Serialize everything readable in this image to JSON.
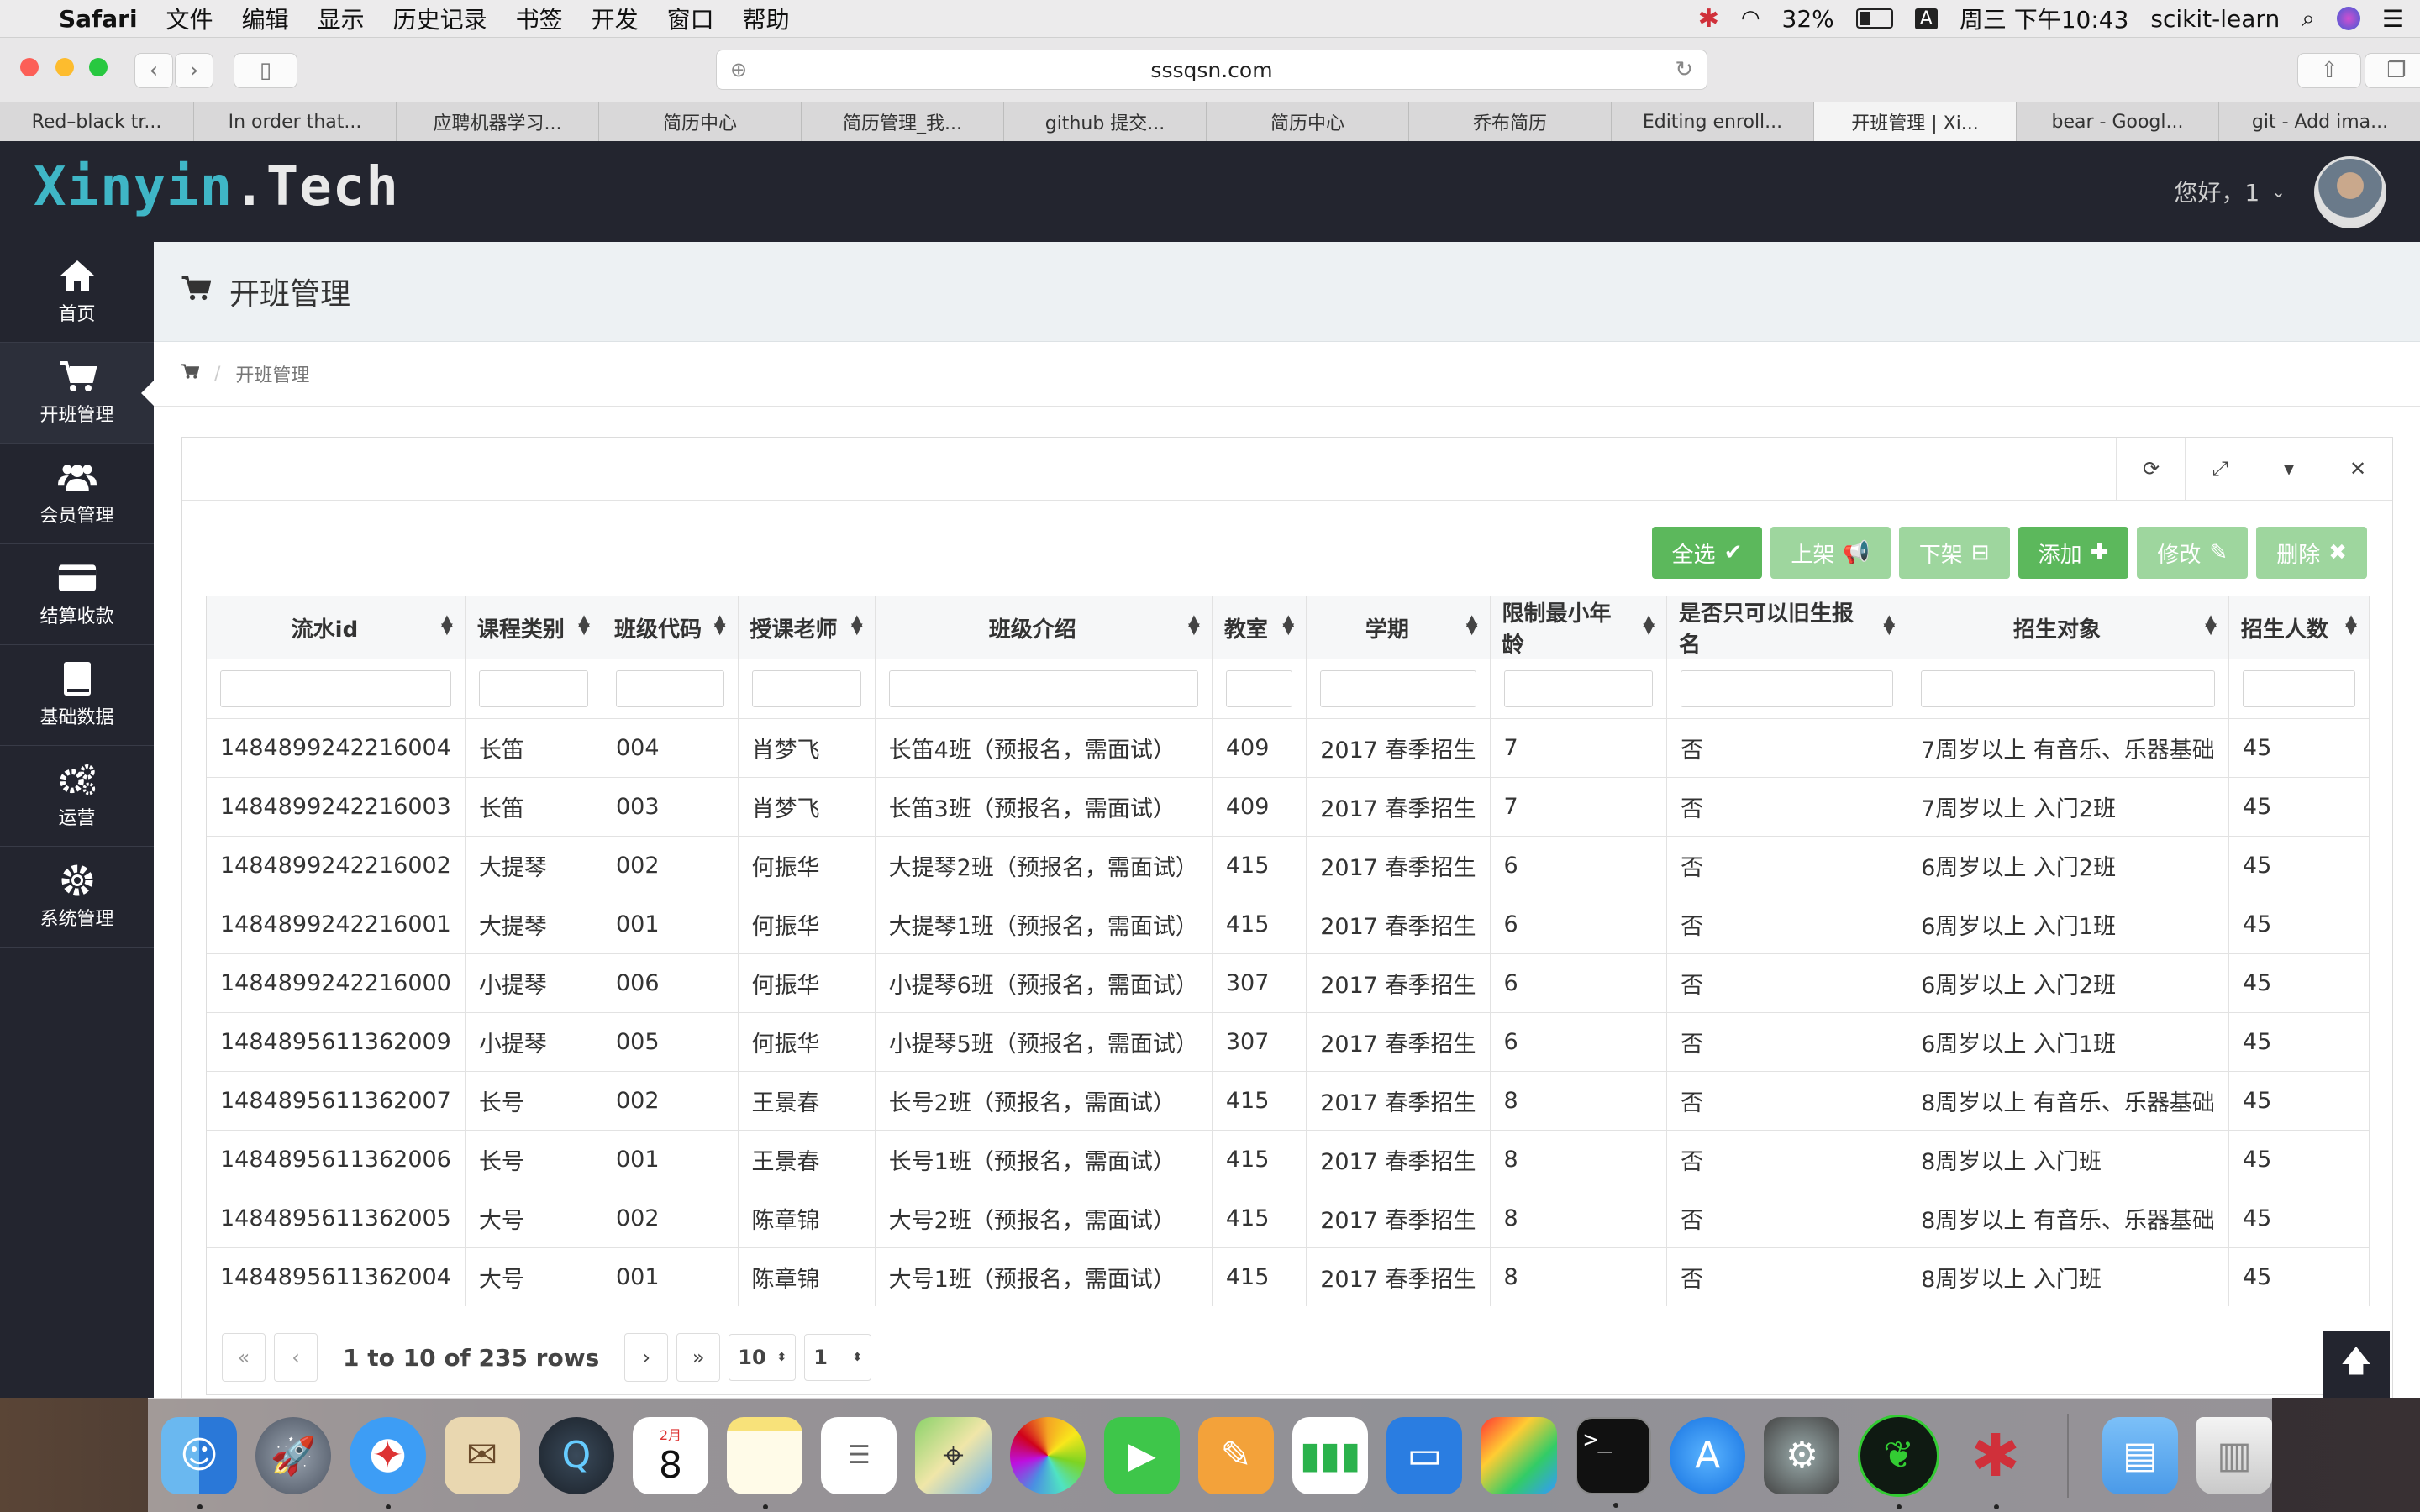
{
  "menubar": {
    "app": "Safari",
    "items": [
      "文件",
      "编辑",
      "显示",
      "历史记录",
      "书签",
      "开发",
      "窗口",
      "帮助"
    ],
    "battery": "32%",
    "input_method": "A",
    "clock": "周三 下午10:43",
    "active_profile": "scikit-learn"
  },
  "browser": {
    "url": "sssqsn.com",
    "tabs": [
      "Red–black tr...",
      "In order that...",
      "应聘机器学习...",
      "简历中心",
      "简历管理_我...",
      "github 提交...",
      "简历中心",
      "乔布简历",
      "Editing enroll...",
      "开班管理 | Xi...",
      "bear - Googl...",
      "git - Add ima..."
    ],
    "active_tab": 9
  },
  "header": {
    "logo_part1": "Xinyin",
    "logo_part2": ".Tech",
    "greeting": "您好，1"
  },
  "sidebar": {
    "items": [
      {
        "label": "首页",
        "icon": "home-icon"
      },
      {
        "label": "开班管理",
        "icon": "cart-icon"
      },
      {
        "label": "会员管理",
        "icon": "users-icon"
      },
      {
        "label": "结算收款",
        "icon": "card-icon"
      },
      {
        "label": "基础数据",
        "icon": "book-icon"
      },
      {
        "label": "运营",
        "icon": "gears-icon"
      },
      {
        "label": "系统管理",
        "icon": "gear-icon"
      }
    ],
    "active": 1
  },
  "page": {
    "title": "开班管理",
    "breadcrumb": "开班管理"
  },
  "actions": {
    "select_all": "全选",
    "publish": "上架",
    "unpublish": "下架",
    "add": "添加",
    "edit": "修改",
    "delete": "删除"
  },
  "table": {
    "columns": [
      "流水id",
      "课程类别",
      "班级代码",
      "授课老师",
      "班级介绍",
      "教室",
      "学期",
      "限制最小年龄",
      "是否只可以旧生报名",
      "招生对象",
      "招生人数"
    ],
    "rows": [
      [
        "1484899242216004",
        "长笛",
        "004",
        "肖梦飞",
        "长笛4班（预报名，需面试）",
        "409",
        "2017 春季招生",
        "7",
        "否",
        "7周岁以上 有音乐、乐器基础",
        "45"
      ],
      [
        "1484899242216003",
        "长笛",
        "003",
        "肖梦飞",
        "长笛3班（预报名，需面试）",
        "409",
        "2017 春季招生",
        "7",
        "否",
        "7周岁以上 入门2班",
        "45"
      ],
      [
        "1484899242216002",
        "大提琴",
        "002",
        "何振华",
        "大提琴2班（预报名，需面试）",
        "415",
        "2017 春季招生",
        "6",
        "否",
        "6周岁以上 入门2班",
        "45"
      ],
      [
        "1484899242216001",
        "大提琴",
        "001",
        "何振华",
        "大提琴1班（预报名，需面试）",
        "415",
        "2017 春季招生",
        "6",
        "否",
        "6周岁以上 入门1班",
        "45"
      ],
      [
        "1484899242216000",
        "小提琴",
        "006",
        "何振华",
        "小提琴6班（预报名，需面试）",
        "307",
        "2017 春季招生",
        "6",
        "否",
        "6周岁以上 入门2班",
        "45"
      ],
      [
        "1484895611362009",
        "小提琴",
        "005",
        "何振华",
        "小提琴5班（预报名，需面试）",
        "307",
        "2017 春季招生",
        "6",
        "否",
        "6周岁以上 入门1班",
        "45"
      ],
      [
        "1484895611362007",
        "长号",
        "002",
        "王景春",
        "长号2班（预报名，需面试）",
        "415",
        "2017 春季招生",
        "8",
        "否",
        "8周岁以上 有音乐、乐器基础",
        "45"
      ],
      [
        "1484895611362006",
        "长号",
        "001",
        "王景春",
        "长号1班（预报名，需面试）",
        "415",
        "2017 春季招生",
        "8",
        "否",
        "8周岁以上 入门班",
        "45"
      ],
      [
        "1484895611362005",
        "大号",
        "002",
        "陈章锦",
        "大号2班（预报名，需面试）",
        "415",
        "2017 春季招生",
        "8",
        "否",
        "8周岁以上 有音乐、乐器基础",
        "45"
      ],
      [
        "1484895611362004",
        "大号",
        "001",
        "陈章锦",
        "大号1班（预报名，需面试）",
        "415",
        "2017 春季招生",
        "8",
        "否",
        "8周岁以上 入门班",
        "45"
      ]
    ]
  },
  "pagination": {
    "info": "1 to 10 of 235 rows",
    "page_size": "10",
    "page": "1"
  },
  "dock": {
    "calendar_month": "2月",
    "calendar_day": "8"
  }
}
